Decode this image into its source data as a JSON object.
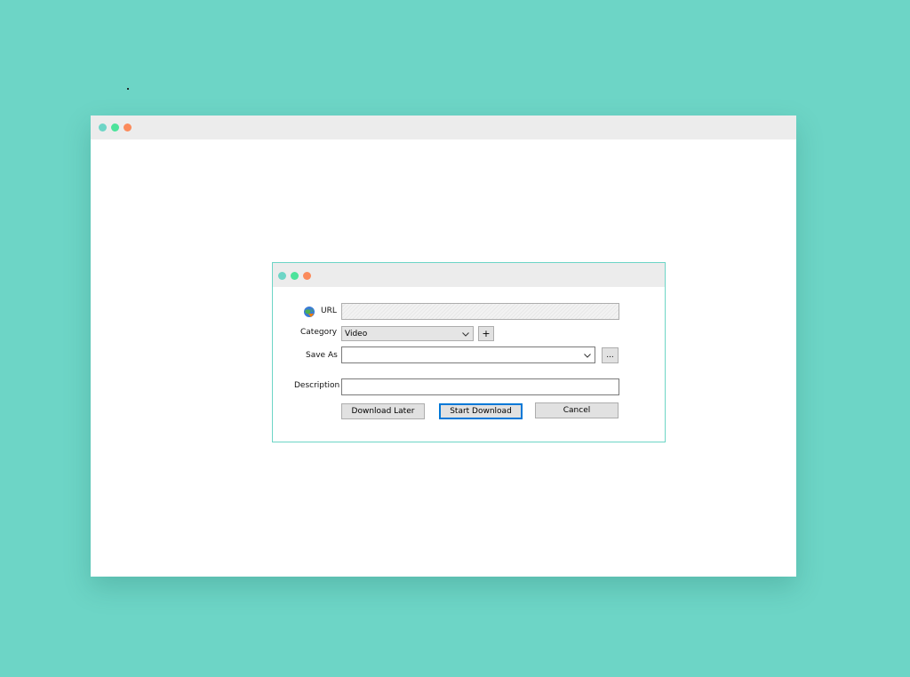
{
  "dialog": {
    "url_label": "URL",
    "url_value": "",
    "category_label": "Category",
    "category_value": "Video",
    "add_category_label": "+",
    "save_as_label": "Save As",
    "save_as_value": "",
    "browse_label": "...",
    "description_label": "Description",
    "description_value": "",
    "download_later_label": "Download Later",
    "start_download_label": "Start Download",
    "cancel_label": "Cancel"
  },
  "icons": {
    "url": "globe-download-icon",
    "dropdown": "chevron-down-icon"
  },
  "colors": {
    "background": "#6dd5c6",
    "window_titlebar": "#ececec",
    "dot_teal": "#6dd5c6",
    "dot_green": "#4de39b",
    "dot_orange": "#fb8b5c",
    "primary_button_border": "#0078d7"
  }
}
